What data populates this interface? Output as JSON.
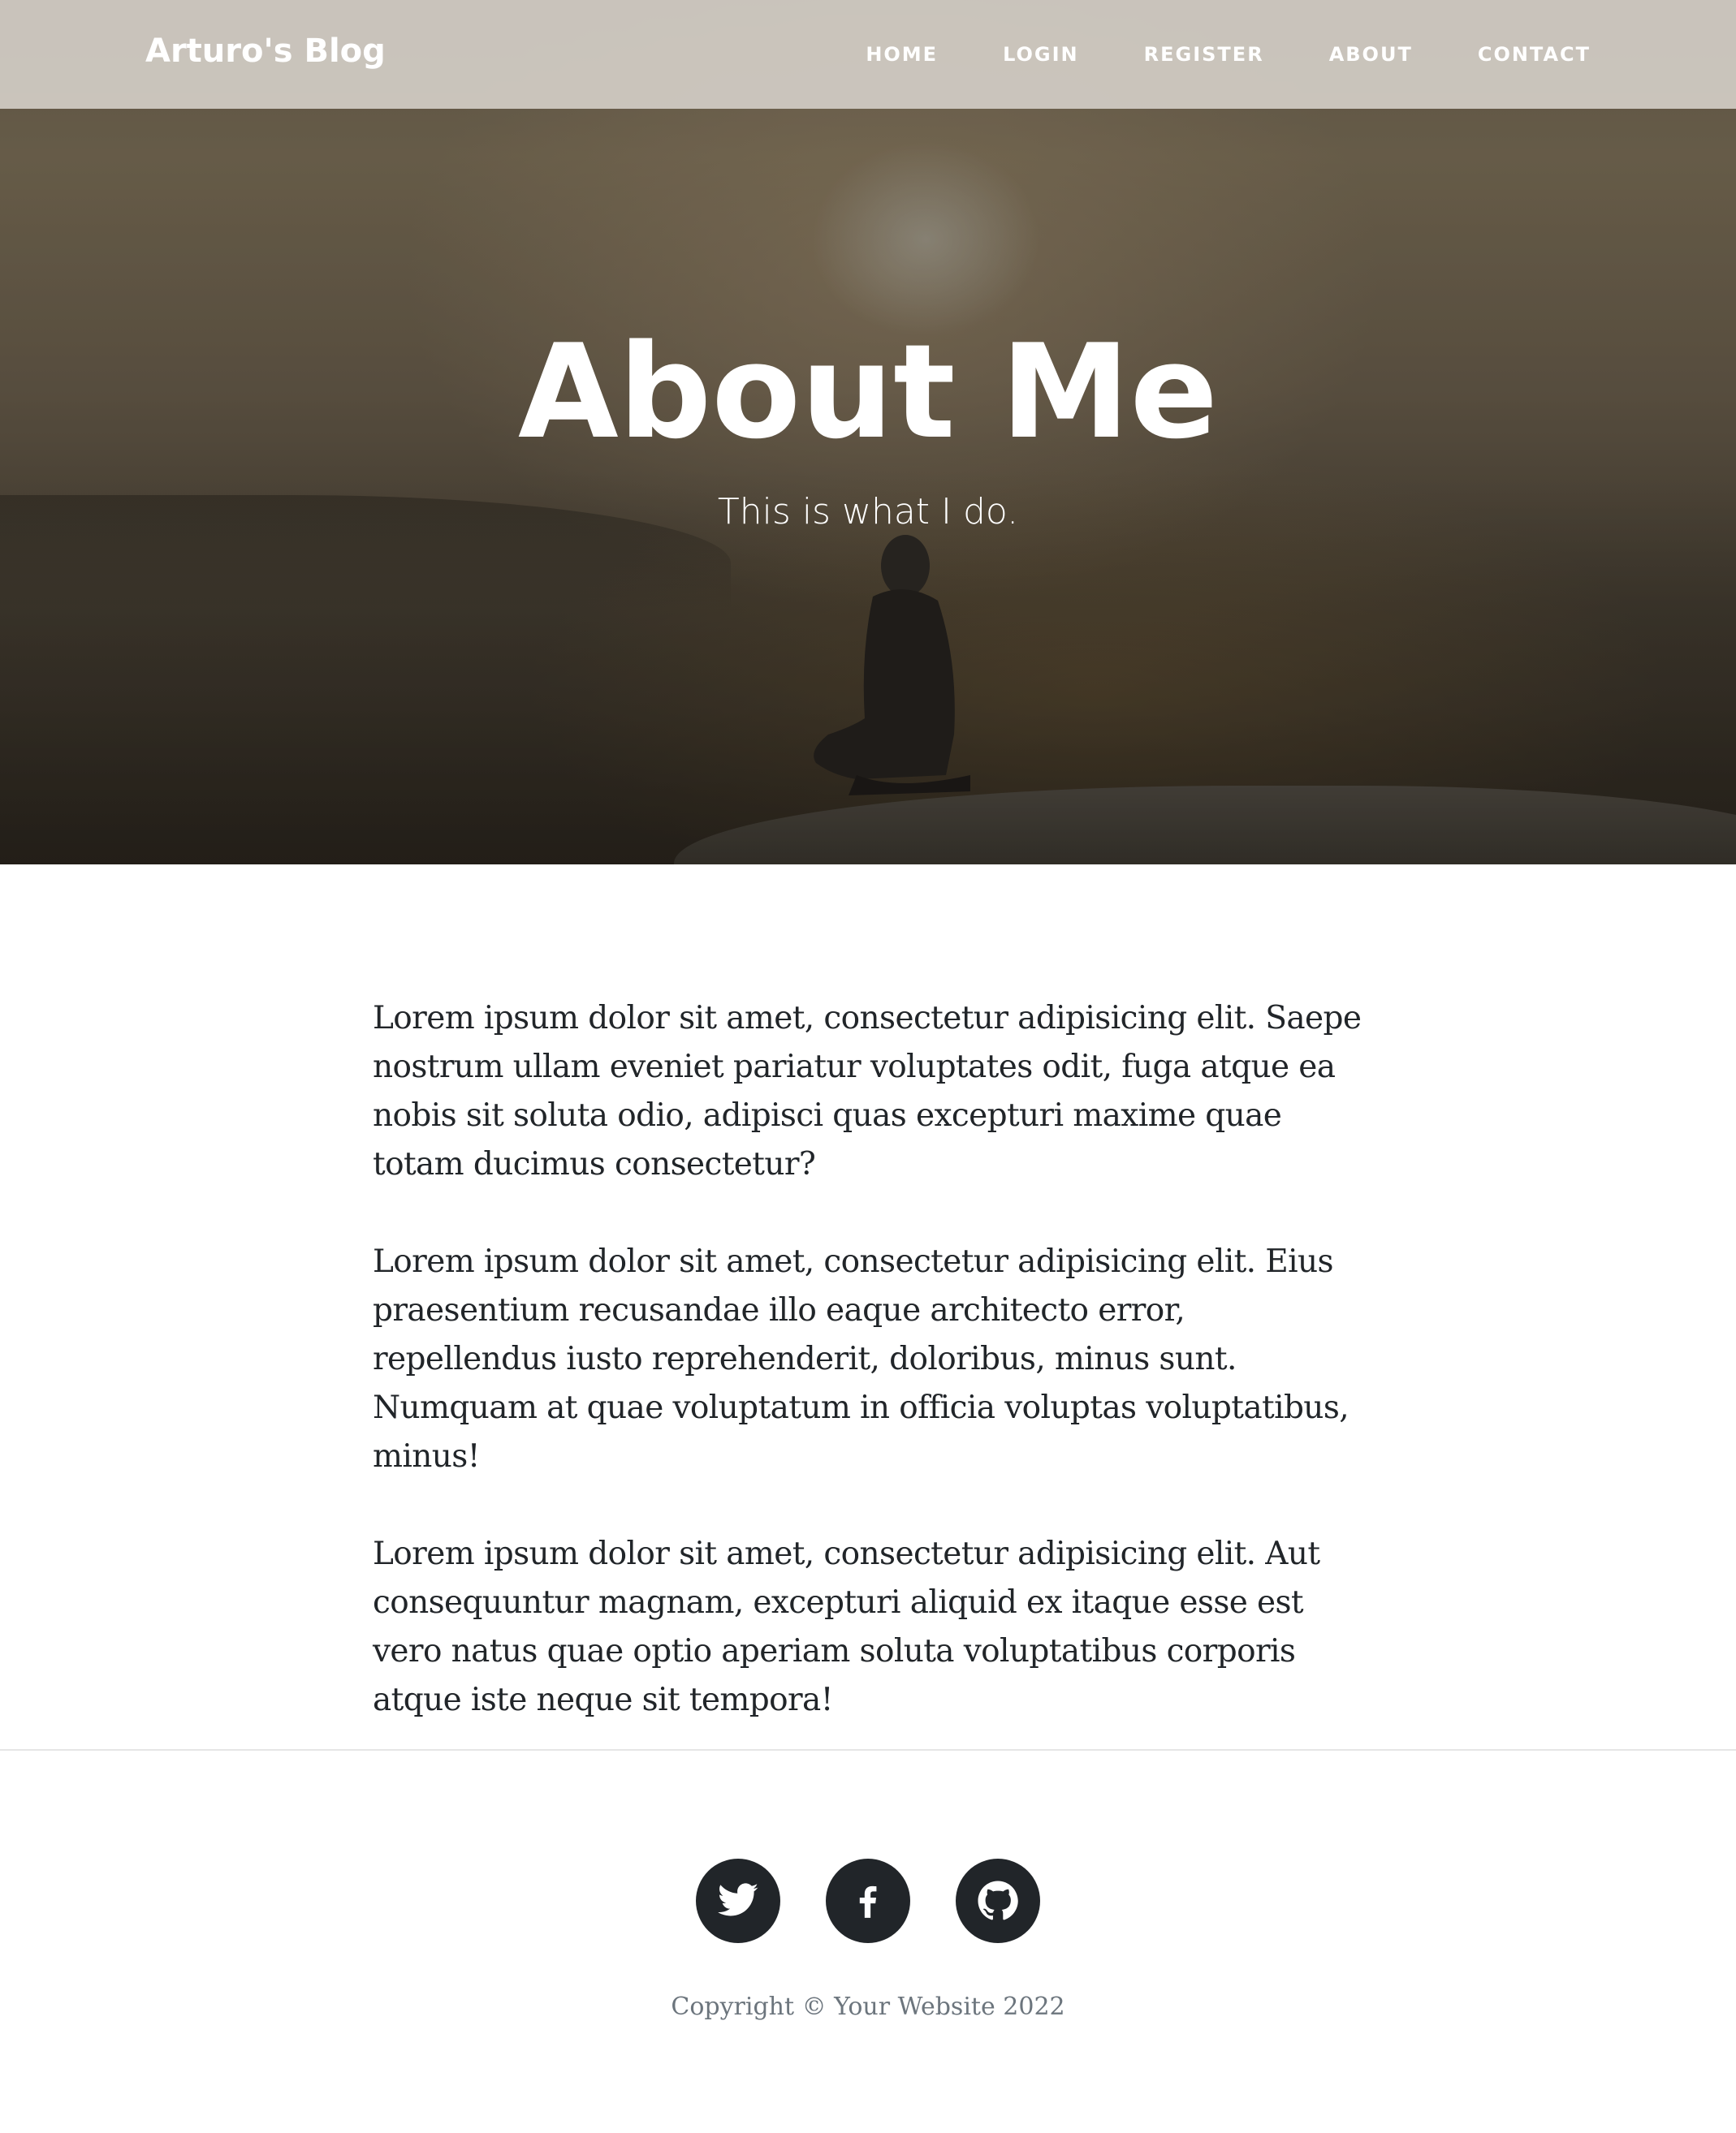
{
  "nav": {
    "brand": "Arturo's Blog",
    "links": [
      "HOME",
      "LOGIN",
      "REGISTER",
      "ABOUT",
      "CONTACT"
    ]
  },
  "hero": {
    "title": "About Me",
    "subtitle": "This is what I do."
  },
  "content": {
    "paragraphs": [
      "Lorem ipsum dolor sit amet, consectetur adipisicing elit. Saepe nostrum ullam eveniet pariatur voluptates odit, fuga atque ea nobis sit soluta odio, adipisci quas excepturi maxime quae totam ducimus consectetur?",
      "Lorem ipsum dolor sit amet, consectetur adipisicing elit. Eius praesentium recusandae illo eaque architecto error, repellendus iusto reprehenderit, doloribus, minus sunt. Numquam at quae voluptatum in officia voluptas voluptatibus, minus!",
      "Lorem ipsum dolor sit amet, consectetur adipisicing elit. Aut consequuntur magnam, excepturi aliquid ex itaque esse est vero natus quae optio aperiam soluta voluptatibus corporis atque iste neque sit tempora!"
    ]
  },
  "footer": {
    "social_icons": [
      "twitter-icon",
      "facebook-icon",
      "github-icon"
    ],
    "copyright": "Copyright © Your Website 2022"
  },
  "colors": {
    "text": "#212529",
    "muted": "#6c757d",
    "social_bg": "#212529"
  }
}
